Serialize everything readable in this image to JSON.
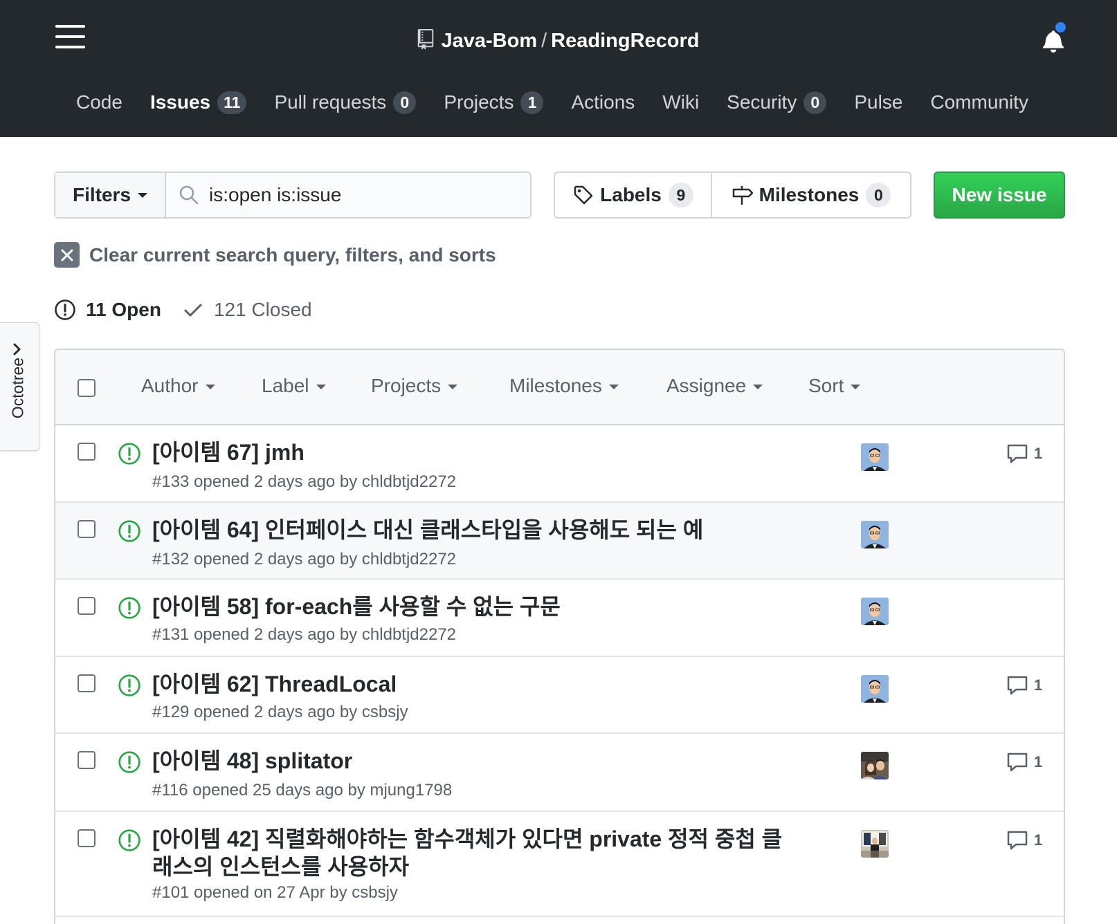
{
  "header": {
    "owner": "Java-Bom",
    "separator": "/",
    "repo": "ReadingRecord",
    "tabs": [
      {
        "label": "Code"
      },
      {
        "label": "Issues",
        "count": "11"
      },
      {
        "label": "Pull requests",
        "count": "0"
      },
      {
        "label": "Projects",
        "count": "1"
      },
      {
        "label": "Actions"
      },
      {
        "label": "Wiki"
      },
      {
        "label": "Security",
        "count": "0"
      },
      {
        "label": "Pulse"
      },
      {
        "label": "Community"
      }
    ],
    "notification_dot_color": "#2f81f7"
  },
  "sidebar": {
    "octotree_label": "Octotree"
  },
  "toolbar": {
    "filters_label": "Filters",
    "search_value": "is:open is:issue",
    "labels_label": "Labels",
    "labels_count": "9",
    "milestones_label": "Milestones",
    "milestones_count": "0",
    "new_issue_label": "New issue"
  },
  "clear_query": "Clear current search query, filters, and sorts",
  "state": {
    "open": "11 Open",
    "closed": "121 Closed"
  },
  "filters": {
    "author": "Author",
    "label": "Label",
    "projects": "Projects",
    "milestones": "Milestones",
    "assignee": "Assignee",
    "sort": "Sort"
  },
  "issues": [
    {
      "title": "[아이템 67] jmh",
      "meta": "#133 opened 2 days ago by chldbtjd2272",
      "comments": "1"
    },
    {
      "title": "[아이템 64] 인터페이스 대신 클래스타입을 사용해도 되는 예",
      "meta": "#132 opened 2 days ago by chldbtjd2272",
      "comments": ""
    },
    {
      "title": "[아이템 58] for-each를 사용할 수 없는 구문",
      "meta": "#131 opened 2 days ago by chldbtjd2272",
      "comments": ""
    },
    {
      "title": "[아이템 62] ThreadLocal",
      "meta": "#129 opened 2 days ago by csbsjy",
      "comments": "1"
    },
    {
      "title": "[아이템 48] splitator",
      "meta": "#116 opened 25 days ago by mjung1798",
      "comments": "1"
    },
    {
      "title": "[아이템 42] 직렬화해야하는 함수객체가 있다면 private 정적 중첩 클래스의 인스턴스를 사용하자",
      "meta": "#101 opened on 27 Apr by csbsjy",
      "comments": "1"
    }
  ],
  "colors": {
    "header_bg": "#24292e",
    "open_icon": "#28a745",
    "new_issue_bg": "#2ea44f"
  }
}
